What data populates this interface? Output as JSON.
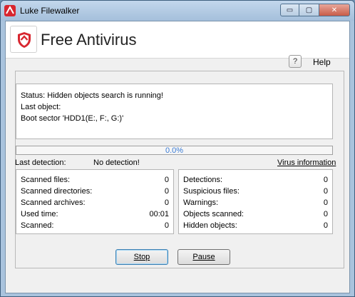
{
  "window": {
    "title": "Luke Filewalker"
  },
  "window_controls": {
    "minimize": "▭",
    "maximize": "▢",
    "close": "✕"
  },
  "header": {
    "app_name": "Free Antivirus"
  },
  "help": {
    "icon": "?",
    "label": "Help"
  },
  "status": {
    "line1": "Status:  Hidden objects search is running!",
    "line2": "Last object:",
    "line3": "Boot sector 'HDD1(E:, F:, G:)'"
  },
  "progress": {
    "percent": 0,
    "text": "0.0%"
  },
  "detection": {
    "label": "Last detection:",
    "value": "No detection!",
    "link": "Virus information"
  },
  "stats_left": [
    {
      "label": "Scanned files:",
      "value": "0"
    },
    {
      "label": "Scanned directories:",
      "value": "0"
    },
    {
      "label": "Scanned archives:",
      "value": "0"
    },
    {
      "label": "Used time:",
      "value": "00:01"
    },
    {
      "label": "Scanned:",
      "value": "0"
    }
  ],
  "stats_right": [
    {
      "label": "Detections:",
      "value": "0"
    },
    {
      "label": "Suspicious files:",
      "value": "0"
    },
    {
      "label": "Warnings:",
      "value": "0"
    },
    {
      "label": "Objects scanned:",
      "value": "0"
    },
    {
      "label": "Hidden objects:",
      "value": "0"
    }
  ],
  "buttons": {
    "stop": "Stop",
    "pause": "Pause"
  },
  "colors": {
    "brand_red": "#d8262f",
    "progress_text": "#3a7bd5"
  }
}
